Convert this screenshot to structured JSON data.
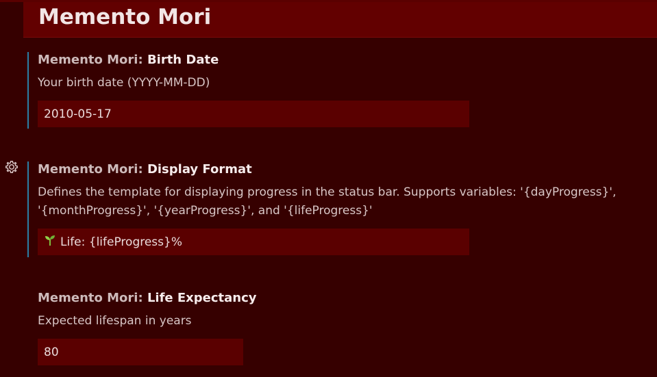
{
  "header": {
    "title": "Memento Mori"
  },
  "settings": [
    {
      "category": "Memento Mori: ",
      "name": "Birth Date",
      "description": "Your birth date (YYYY-MM-DD)",
      "value": "2010-05-17"
    },
    {
      "category": "Memento Mori: ",
      "name": "Display Format",
      "description": "Defines the template for displaying progress in the status bar. Supports variables: '{dayProgress}', '{monthProgress}', '{yearProgress}', and '{lifeProgress}'",
      "value_icon": "seedling-icon",
      "value": "Life: {lifeProgress}%"
    },
    {
      "category": "Memento Mori: ",
      "name": "Life Expectancy",
      "description": "Expected lifespan in years",
      "value": "80"
    }
  ],
  "icons": {
    "gear": "gear-icon"
  },
  "colors": {
    "background": "#360000",
    "header": "#620000",
    "input": "#5a0000",
    "modified_bar": "#2a7fa6"
  }
}
